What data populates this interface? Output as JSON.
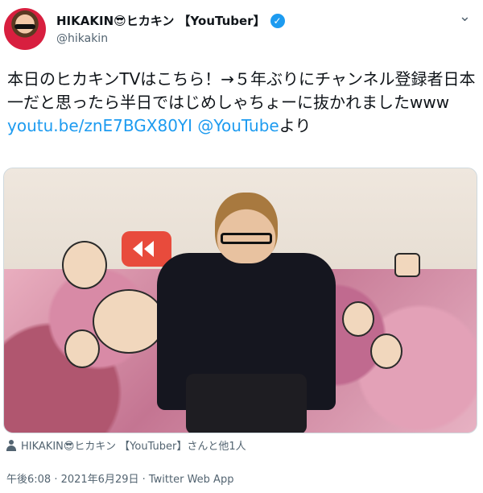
{
  "header": {
    "display_name": "HIKAKIN😎ヒカキン 【YouTuber】",
    "handle": "@hikakin",
    "more": "⌄"
  },
  "tweet": {
    "text_before_link": "本日のヒカキンTVはこちら！→５年ぶりにチャンネル登録者日本一だと思ったら半日ではじめしゃちょーに抜かれましたwww ",
    "link": "youtu.be/znE7BGX80YI",
    "mention": "@YouTube",
    "text_after": "より"
  },
  "media": {
    "alt": ""
  },
  "footer": {
    "liked_by": "HIKAKIN😎ヒカキン 【YouTuber】さんと他1人",
    "timestamp": "午後6:08 · 2021年6月29日 · Twitter Web App"
  },
  "icons": [
    "avatar",
    "verified-badge-icon",
    "more-icon",
    "person-icon"
  ],
  "colors": {
    "accent": "#1d9bf0",
    "muted": "#536471",
    "text": "#0f1419"
  }
}
